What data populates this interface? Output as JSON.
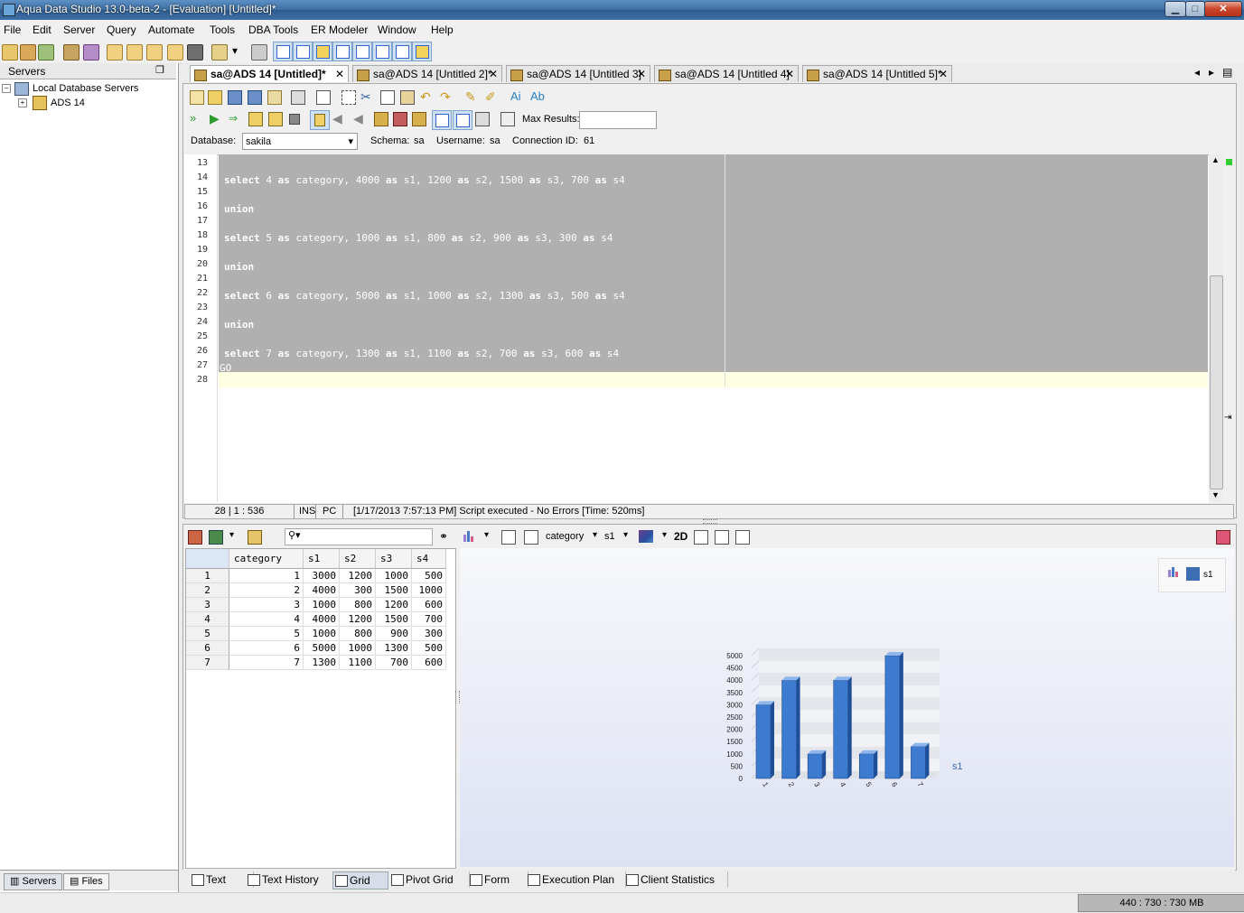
{
  "window": {
    "title": "Aqua Data Studio 13.0-beta-2 - [Evaluation] [Untitled]*"
  },
  "menu": [
    "File",
    "Edit",
    "Server",
    "Query",
    "Automate",
    "Tools",
    "DBA Tools",
    "ER Modeler",
    "Window",
    "Help"
  ],
  "servers_panel": {
    "header": "Servers",
    "root": "Local Database Servers",
    "child": "ADS 14",
    "tabs": [
      "Servers",
      "Files"
    ]
  },
  "doc_tabs": [
    {
      "label": "sa@ADS 14 [Untitled]*",
      "close": "✕"
    },
    {
      "label": "sa@ADS 14 [Untitled 2]*",
      "close": "✕"
    },
    {
      "label": "sa@ADS 14 [Untitled 3]",
      "close": "✕"
    },
    {
      "label": "sa@ADS 14 [Untitled 4]",
      "close": "✕"
    },
    {
      "label": "sa@ADS 14 [Untitled 5]*",
      "close": "✕"
    }
  ],
  "query_toolbar": {
    "max_results_label": "Max Results:",
    "max_results_value": "",
    "database_label": "Database:",
    "database_value": "sakila",
    "schema_label": "Schema:",
    "schema_value": "sa",
    "username_label": "Username:",
    "username_value": "sa",
    "connection_label": "Connection ID:",
    "connection_value": "61"
  },
  "editor": {
    "lines": [
      {
        "n": "13",
        "text": ""
      },
      {
        "n": "14",
        "text": "select 4 as category, 4000 as s1, 1200 as s2, 1500 as s3, 700 as s4"
      },
      {
        "n": "15",
        "text": ""
      },
      {
        "n": "16",
        "text": "union"
      },
      {
        "n": "17",
        "text": ""
      },
      {
        "n": "18",
        "text": "select 5 as category, 1000 as s1, 800 as s2, 900 as s3, 300 as s4"
      },
      {
        "n": "19",
        "text": ""
      },
      {
        "n": "20",
        "text": "union"
      },
      {
        "n": "21",
        "text": ""
      },
      {
        "n": "22",
        "text": "select 6 as category, 5000 as s1, 1000 as s2, 1300 as s3, 500 as s4"
      },
      {
        "n": "23",
        "text": ""
      },
      {
        "n": "24",
        "text": "union"
      },
      {
        "n": "25",
        "text": ""
      },
      {
        "n": "26",
        "text": "select 7 as category, 1300 as s1, 1100 as s2, 700 as s3, 600 as s4"
      },
      {
        "n": "27",
        "text": "GO"
      },
      {
        "n": "28",
        "text": ""
      }
    ]
  },
  "status": {
    "position": "28 | 1 : 536",
    "mode": "INS",
    "eol": "PC",
    "message": "[1/17/2013 7:57:13 PM] Script executed - No Errors [Time: 520ms]"
  },
  "results_toolbar": {
    "search_placeholder": "",
    "category_combo": "category",
    "series_combo": "s1",
    "view_mode": "2D"
  },
  "grid": {
    "columns": [
      "category",
      "s1",
      "s2",
      "s3",
      "s4"
    ],
    "rows": [
      [
        "1",
        "1",
        "3000",
        "1200",
        "1000",
        "500"
      ],
      [
        "2",
        "2",
        "4000",
        "300",
        "1500",
        "1000"
      ],
      [
        "3",
        "3",
        "1000",
        "800",
        "1200",
        "600"
      ],
      [
        "4",
        "4",
        "4000",
        "1200",
        "1500",
        "700"
      ],
      [
        "5",
        "5",
        "1000",
        "800",
        "900",
        "300"
      ],
      [
        "6",
        "6",
        "5000",
        "1000",
        "1300",
        "500"
      ],
      [
        "7",
        "7",
        "1300",
        "1100",
        "700",
        "600"
      ]
    ]
  },
  "chart_data": {
    "type": "bar",
    "categories": [
      "1",
      "2",
      "3",
      "4",
      "5",
      "6",
      "7"
    ],
    "series": [
      {
        "name": "s1",
        "values": [
          3000,
          4000,
          1000,
          4000,
          1000,
          5000,
          1300
        ]
      }
    ],
    "yticks": [
      "0",
      "500",
      "1000",
      "1500",
      "2000",
      "2500",
      "3000",
      "3500",
      "4000",
      "4500",
      "5000"
    ],
    "ylim": [
      0,
      5000
    ],
    "bar_color": "#3d7bd0",
    "legend_position": "top-right",
    "series_label": "s1"
  },
  "results_tabs": [
    "Text",
    "Text History",
    "Grid",
    "Pivot Grid",
    "Form",
    "Execution Plan",
    "Client Statistics"
  ],
  "memory": "440 : 730 : 730 MB"
}
